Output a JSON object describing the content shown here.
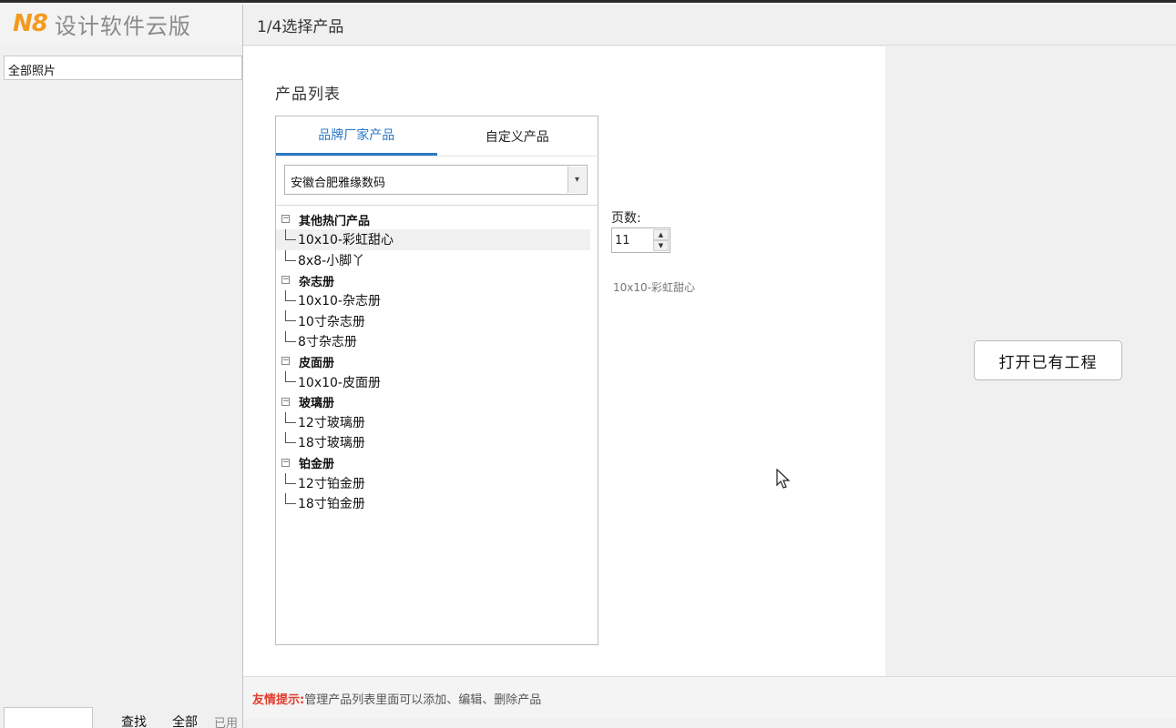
{
  "app": {
    "logo_letters": "N8",
    "title": "设计软件云版",
    "album_select": "全部照片",
    "bottom_bar": {
      "find": "查找",
      "all": "全部",
      "used": "已用"
    }
  },
  "dialog": {
    "title": "1/4选择产品",
    "list_title": "产品列表",
    "tabs": [
      {
        "label": "品牌厂家产品",
        "active": true
      },
      {
        "label": "自定义产品",
        "active": false
      }
    ],
    "brand_selected": "安徽合肥雅缘数码",
    "tree": [
      {
        "group": "其他热门产品",
        "items": [
          "10x10-彩虹甜心",
          "8x8-小脚丫"
        ]
      },
      {
        "group": "杂志册",
        "items": [
          "10x10-杂志册",
          "10寸杂志册",
          "8寸杂志册"
        ]
      },
      {
        "group": "皮面册",
        "items": [
          "10x10-皮面册"
        ]
      },
      {
        "group": "玻璃册",
        "items": [
          "12寸玻璃册",
          "18寸玻璃册"
        ]
      },
      {
        "group": "铂金册",
        "items": [
          "12寸铂金册",
          "18寸铂金册"
        ]
      }
    ],
    "selected_item": "10x10-彩虹甜心",
    "pages_label": "页数:",
    "pages_value": "11",
    "selected_product_label": "10x10-彩虹甜心",
    "open_button": "打开已有工程",
    "tip_label": "友情提示:",
    "tip_text": "管理产品列表里面可以添加、编辑、删除产品"
  },
  "colors": {
    "accent": "#2b78c5",
    "logo": "#f39a1c",
    "tip": "#e23c2c"
  }
}
